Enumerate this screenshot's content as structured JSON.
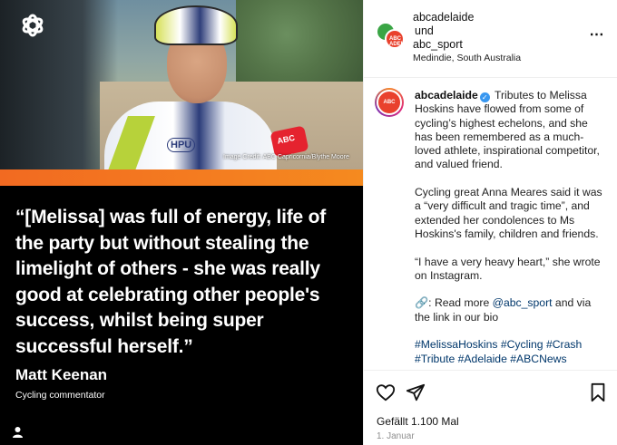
{
  "post_image": {
    "brand_logo": "abc-logo",
    "image_credit": "Image Credit: ABC Capricornia/Blythe Moore",
    "jersey_text": "HPU",
    "mic_text": "ABC",
    "quote": "“[Melissa] was full of energy, life of the party but without stealing the limelight of others - she was really good at celebrating other people's success, whilst being super successful herself.”",
    "person_name": "Matt Keenan",
    "person_role": "Cycling commentator",
    "accent_color": "#f26a21"
  },
  "header": {
    "account_1": "abcadelaide",
    "joiner": "und",
    "account_2": "abc_sport",
    "location": "Medindie, South Australia",
    "avatar_text": "ABC ADELAIDE"
  },
  "caption": {
    "username": "abcadelaide",
    "verified_icon": "✓",
    "p1": "Tributes to Melissa Hoskins have flowed from some of cycling’s highest echelons, and she has been remembered as a much-loved athlete, inspirational competitor, and valued friend.",
    "p2": "Cycling great Anna Meares said it was a “very difficult and tragic time”, and extended her condolences to Ms Hoskins's family, children and friends.",
    "p3": "“I have a very heavy heart,” she wrote on Instagram.",
    "p4_prefix": "🔗: Read more ",
    "p4_link": "@abc_sport",
    "p4_suffix": " and via the link in our bio",
    "hashtags": "#MelissaHoskins #Cycling #Crash #Tribute #Adelaide #ABCNews"
  },
  "actions": {
    "likes": "Gefällt 1.100 Mal",
    "date": "1. Januar"
  }
}
